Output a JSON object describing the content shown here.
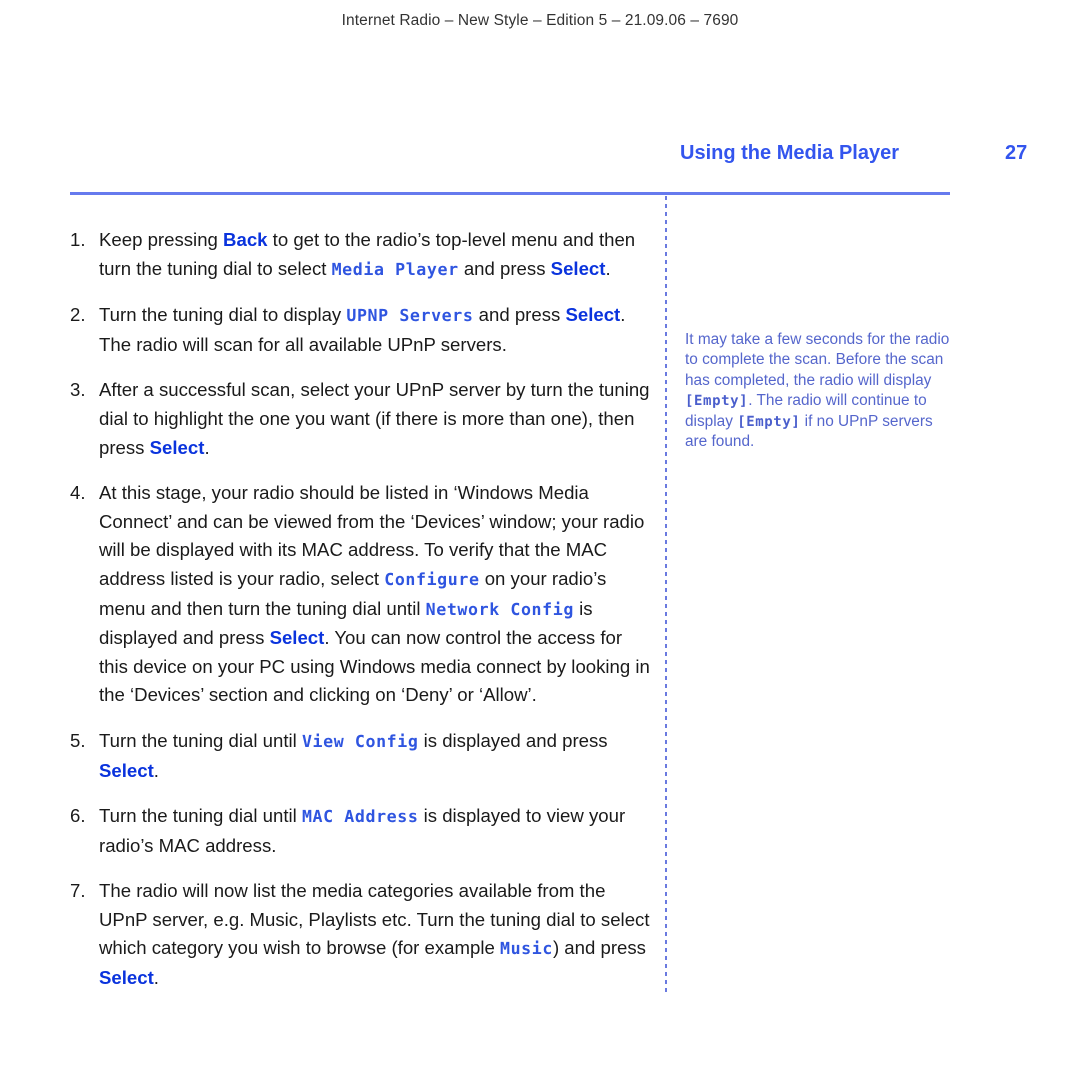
{
  "document": {
    "running_header": "Internet Radio – New Style – Edition 5 – 21.09.06 – 7690",
    "chapter_title": "Using the Media Player",
    "page_number": "27"
  },
  "colors": {
    "accent_blue": "#3355ee",
    "key_blue": "#0a33dd",
    "lcd_blue": "#2f55e0",
    "note_blue": "#5566cc",
    "rule_blue": "#667aee"
  },
  "steps": [
    {
      "number": "1.",
      "parts": [
        {
          "t": "Keep pressing ",
          "s": "plain"
        },
        {
          "t": "Back",
          "s": "key"
        },
        {
          "t": " to get to the radio’s top-level menu and then turn the tuning dial to select ",
          "s": "plain"
        },
        {
          "t": "Media Player",
          "s": "lcd"
        },
        {
          "t": " and press ",
          "s": "plain"
        },
        {
          "t": "Select",
          "s": "key"
        },
        {
          "t": ".",
          "s": "plain"
        }
      ]
    },
    {
      "number": "2.",
      "parts": [
        {
          "t": "Turn the tuning dial to display ",
          "s": "plain"
        },
        {
          "t": "UPNP Servers",
          "s": "lcd"
        },
        {
          "t": " and press ",
          "s": "plain"
        },
        {
          "t": "Select",
          "s": "key"
        },
        {
          "t": ". The radio will scan for all available UPnP servers.",
          "s": "plain"
        }
      ]
    },
    {
      "number": "3.",
      "parts": [
        {
          "t": "After a successful scan, select your UPnP server by turn the tuning dial to highlight the one you want (if there is more than one), then press ",
          "s": "plain"
        },
        {
          "t": "Select",
          "s": "key"
        },
        {
          "t": ".",
          "s": "plain"
        }
      ]
    },
    {
      "number": "4.",
      "parts": [
        {
          "t": "At this stage, your radio should be listed in ‘Windows Media Connect’ and can be viewed from the ‘Devices’ window; your radio will be displayed with its MAC address. To verify that the MAC address listed is your radio, select ",
          "s": "plain"
        },
        {
          "t": "Configure",
          "s": "lcd"
        },
        {
          "t": " on your radio’s menu and then turn the tuning dial until ",
          "s": "plain"
        },
        {
          "t": "Network Config",
          "s": "lcd"
        },
        {
          "t": " is displayed and press ",
          "s": "plain"
        },
        {
          "t": "Select",
          "s": "key"
        },
        {
          "t": ". You can now control the access for this device on your PC using Windows media connect by looking in the ‘Devices’ section and clicking on ‘Deny’ or ‘Allow’.",
          "s": "plain"
        }
      ]
    },
    {
      "number": "5.",
      "parts": [
        {
          "t": "Turn the tuning dial until ",
          "s": "plain"
        },
        {
          "t": "View Config",
          "s": "lcd"
        },
        {
          "t": " is displayed and press ",
          "s": "plain"
        },
        {
          "t": "Select",
          "s": "key"
        },
        {
          "t": ".",
          "s": "plain"
        }
      ]
    },
    {
      "number": "6.",
      "parts": [
        {
          "t": "Turn the tuning dial until ",
          "s": "plain"
        },
        {
          "t": "MAC Address",
          "s": "lcd"
        },
        {
          "t": " is displayed to view your radio’s MAC address.",
          "s": "plain"
        }
      ]
    },
    {
      "number": "7.",
      "parts": [
        {
          "t": "The radio will now list the media categories available from the UPnP server, e.g. Music, Playlists etc. Turn the tuning dial to select which category you wish to browse (for example ",
          "s": "plain"
        },
        {
          "t": "Music",
          "s": "lcd"
        },
        {
          "t": ") and press ",
          "s": "plain"
        },
        {
          "t": "Select",
          "s": "key"
        },
        {
          "t": ".",
          "s": "plain"
        }
      ]
    }
  ],
  "sidebar": {
    "note_parts": [
      {
        "t": "It may take a few seconds for the radio to complete the scan. Before the scan has completed, the radio will display ",
        "s": "plain"
      },
      {
        "t": "[Empty]",
        "s": "lcd"
      },
      {
        "t": ". The radio will continue to display ",
        "s": "plain"
      },
      {
        "t": "[Empty]",
        "s": "lcd"
      },
      {
        "t": " if no UPnP servers are found.",
        "s": "plain"
      }
    ]
  }
}
